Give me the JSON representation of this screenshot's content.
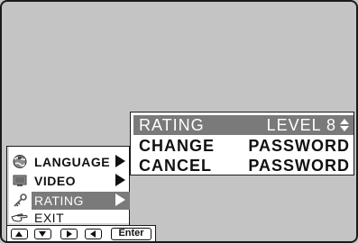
{
  "main_menu": {
    "items": [
      {
        "label": "LANGUAGE",
        "icon": "globe-icon",
        "has_submenu": true
      },
      {
        "label": "VIDEO",
        "icon": "monitor-icon",
        "has_submenu": true
      },
      {
        "label": "RATING",
        "icon": "key-icon",
        "has_submenu": true,
        "selected": true
      },
      {
        "label": "EXIT",
        "icon": "pointing-hand-icon",
        "has_submenu": false
      }
    ]
  },
  "sub_menu": {
    "rows": [
      {
        "left": "RATING",
        "right": "LEVEL 8",
        "selected": true
      },
      {
        "left": "CHANGE",
        "right": "PASSWORD",
        "selected": false
      },
      {
        "left": "CANCEL",
        "right": "PASSWORD",
        "selected": false
      }
    ]
  },
  "nav_bar": {
    "buttons": [
      "up-arrow-icon",
      "down-arrow-icon",
      "right-arrow-icon",
      "left-arrow-icon"
    ],
    "enter_label": "Enter"
  },
  "colors": {
    "background": "#c4c4c4",
    "menu_bg": "#ffffff",
    "highlight": "#7a7a7a",
    "text": "#111111"
  }
}
